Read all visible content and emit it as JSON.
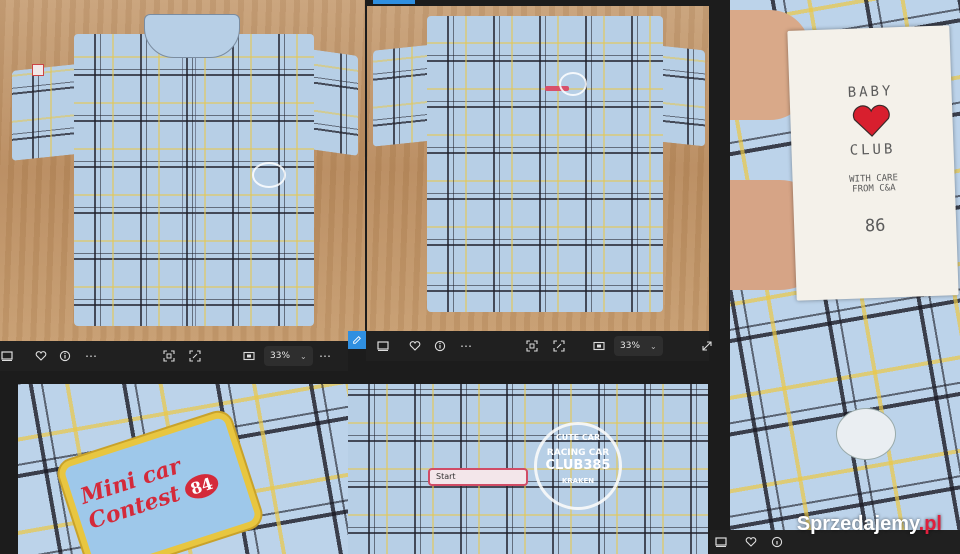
{
  "viewer": {
    "zoom_left": "33%",
    "zoom_middle": "33%"
  },
  "tag": {
    "brand_line1": "BABY",
    "brand_line2": "CLUB",
    "care_line1": "WITH CARE",
    "care_line2": "FROM C&A",
    "size": "86"
  },
  "patch": {
    "line1": "Mini car",
    "line2": "Contest",
    "number": "84"
  },
  "stamp": {
    "top": "CUTE CAR",
    "middle": "RACING CAR",
    "bottom": "CLUB385",
    "base": "KRAKEN",
    "ribbon": "Start"
  },
  "watermark": {
    "text": "Sprzedajemy",
    "suffix": ".pl"
  },
  "colors": {
    "toolbar_bg": "#202020",
    "accent_blue": "#2f8fe0",
    "watermark_dot": "#e01f3d"
  }
}
